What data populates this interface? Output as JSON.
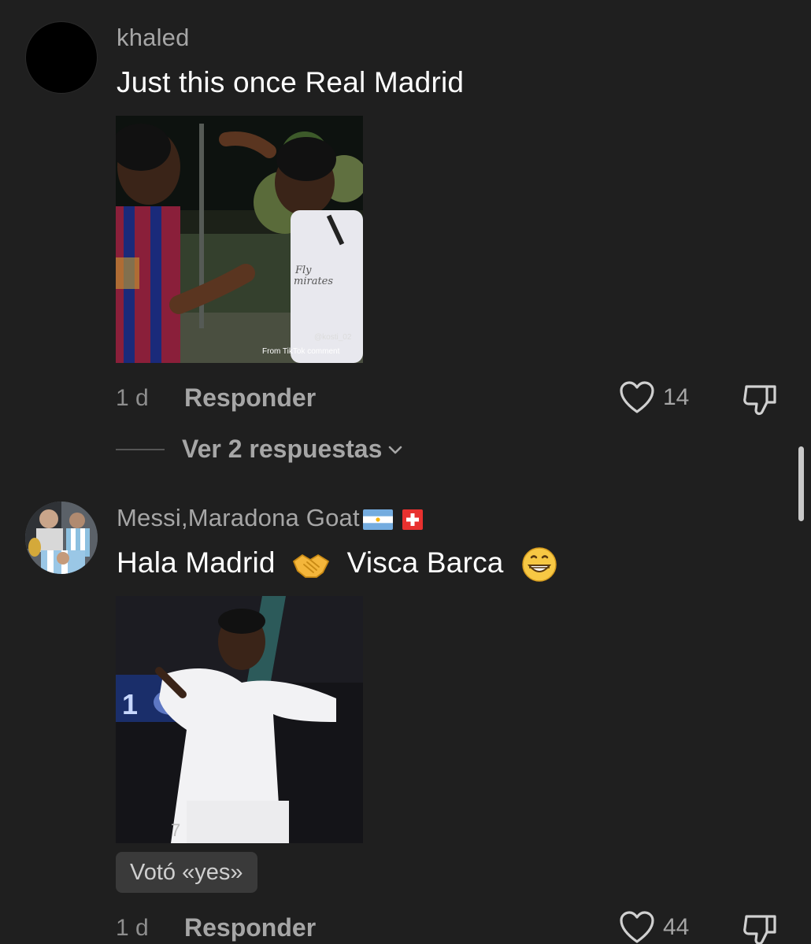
{
  "comments": [
    {
      "username": "khaled",
      "text": "Just this once Real Madrid",
      "time": "1 d",
      "reply_label": "Responder",
      "likes": "14",
      "view_replies_label": "Ver 2 respuestas",
      "media_watermark_handle": "@kosti_02",
      "media_watermark_source": "From TikTok comment"
    },
    {
      "username": "Messi,Maradona Goat",
      "text_part1": "Hala Madrid",
      "text_part2": "Visca Barca",
      "time": "1 d",
      "reply_label": "Responder",
      "likes": "44",
      "poll_badge": "Votó «yes»"
    }
  ],
  "icons": {
    "like": "heart-outline-icon",
    "dislike": "thumbs-down-icon",
    "chevron": "chevron-down-icon"
  },
  "colors": {
    "background": "#1f1f1f",
    "secondary_text": "#a6a6a6",
    "primary_text": "#ffffff"
  }
}
